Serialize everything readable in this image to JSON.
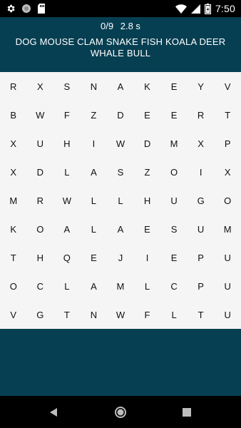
{
  "status_bar": {
    "time": "7:50",
    "left_icons": [
      "gear-icon",
      "circle-icon",
      "sd-card-icon"
    ],
    "right_icons": [
      "wifi-icon",
      "cell-signal-icon",
      "battery-icon"
    ]
  },
  "header": {
    "found": "0/9",
    "elapsed": "2.8 s",
    "words": [
      "DOG",
      "MOUSE",
      "CLAM",
      "SNAKE",
      "FISH",
      "KOALA",
      "DEER",
      "WHALE",
      "BULL"
    ]
  },
  "grid": {
    "rows": [
      [
        "R",
        "X",
        "S",
        "N",
        "A",
        "K",
        "E",
        "Y",
        "V"
      ],
      [
        "B",
        "W",
        "F",
        "Z",
        "D",
        "E",
        "E",
        "R",
        "T"
      ],
      [
        "X",
        "U",
        "H",
        "I",
        "W",
        "D",
        "M",
        "X",
        "P"
      ],
      [
        "X",
        "D",
        "L",
        "A",
        "S",
        "Z",
        "O",
        "I",
        "X"
      ],
      [
        "M",
        "R",
        "W",
        "L",
        "L",
        "H",
        "U",
        "G",
        "O"
      ],
      [
        "K",
        "O",
        "A",
        "L",
        "A",
        "E",
        "S",
        "U",
        "M"
      ],
      [
        "T",
        "H",
        "Q",
        "E",
        "J",
        "I",
        "E",
        "P",
        "U"
      ],
      [
        "O",
        "C",
        "L",
        "A",
        "M",
        "L",
        "C",
        "P",
        "U"
      ],
      [
        "V",
        "G",
        "T",
        "N",
        "W",
        "F",
        "L",
        "T",
        "U"
      ]
    ]
  },
  "nav_bar": {
    "icons": [
      "back-icon",
      "home-icon",
      "recents-icon"
    ]
  },
  "colors": {
    "header_bg": "#073f52",
    "grid_bg": "#f5f5f5",
    "status_bg": "#000000",
    "text_light": "#ffffff",
    "text_dark": "#111111"
  }
}
